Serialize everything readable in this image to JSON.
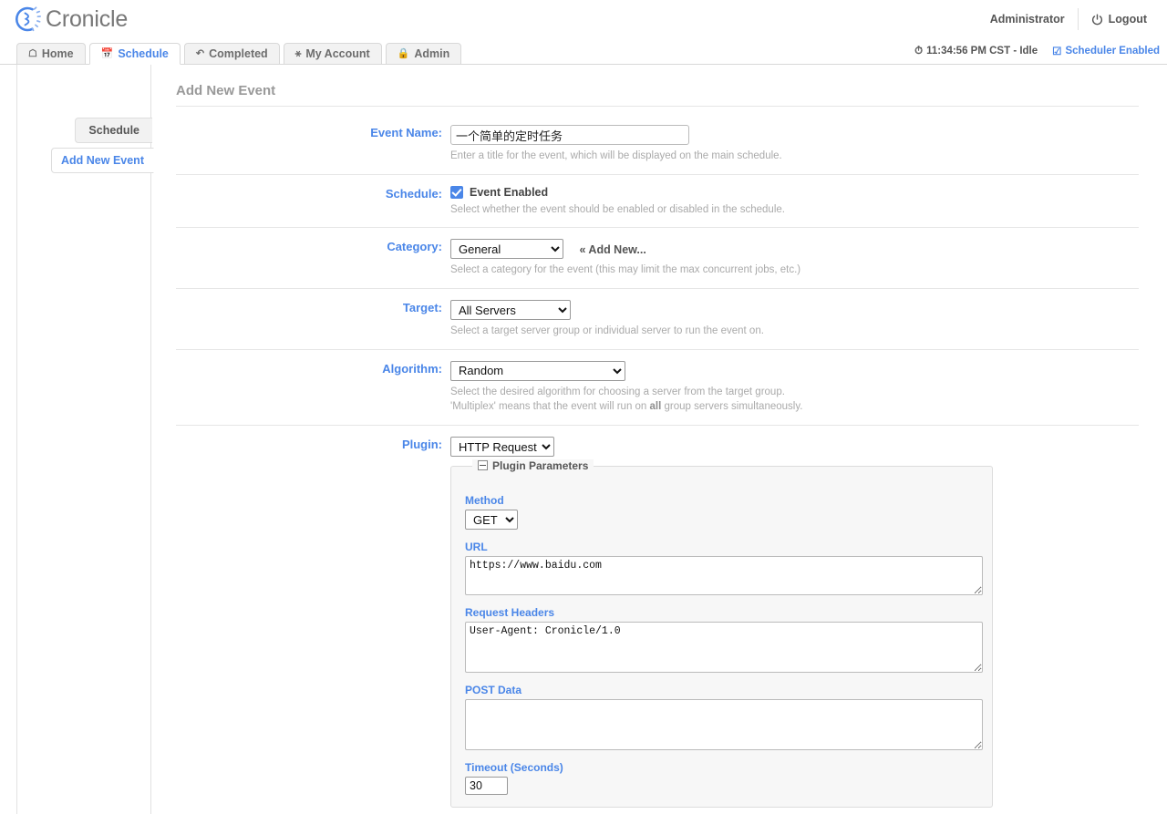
{
  "app": {
    "brand": "Cronicle",
    "logo_icon": "cronicle-clock-logo",
    "accent_color": "#4a86e8",
    "muted_color": "#aaaaaa"
  },
  "header": {
    "user_label": "Administrator",
    "logout_label": "Logout",
    "logout_icon": "power-icon"
  },
  "tabs": [
    {
      "label": "Home",
      "icon": "home-icon",
      "glyph": "⌂",
      "active": false
    },
    {
      "label": "Schedule",
      "icon": "calendar-clock-icon",
      "glyph": "Ὄ5",
      "active": true
    },
    {
      "label": "Completed",
      "icon": "history-icon",
      "glyph": "↺",
      "active": false
    },
    {
      "label": "My Account",
      "icon": "user-icon",
      "glyph": "⚹",
      "active": false
    },
    {
      "label": "Admin",
      "icon": "lock-icon",
      "glyph": "ὑ2",
      "active": false
    }
  ],
  "status_bar": {
    "clock_icon": "clock-icon",
    "time_text": "11:34:56 PM CST - Idle",
    "scheduler_check_icon": "checkbox-checked-icon",
    "scheduler_label": "Scheduler Enabled"
  },
  "sidebar": {
    "items": [
      {
        "label": "Schedule",
        "active": false
      },
      {
        "label": "Add New Event",
        "active": true
      }
    ]
  },
  "main": {
    "page_title": "Add New Event",
    "rows": {
      "event_name": {
        "label": "Event Name:",
        "value": "一个简单的定时任务",
        "placeholder": "",
        "caption": "Enter a title for the event, which will be displayed on the main schedule."
      },
      "schedule": {
        "label": "Schedule:",
        "checkbox_label": "Event Enabled",
        "checked": true,
        "caption": "Select whether the event should be enabled or disabled in the schedule."
      },
      "category": {
        "label": "Category:",
        "value": "General",
        "options": [
          "General"
        ],
        "add_new_label": "« Add New...",
        "caption": "Select a category for the event (this may limit the max concurrent jobs, etc.)"
      },
      "target": {
        "label": "Target:",
        "value": "All Servers",
        "options": [
          "All Servers"
        ],
        "caption": "Select a target server group or individual server to run the event on."
      },
      "algorithm": {
        "label": "Algorithm:",
        "value": "Random",
        "options": [
          "Random"
        ],
        "caption_line1": "Select the desired algorithm for choosing a server from the target group.",
        "caption_line2_pre": "'Multiplex' means that the event will run on ",
        "caption_line2_bold": "all",
        "caption_line2_post": " group servers simultaneously."
      },
      "plugin": {
        "label": "Plugin:",
        "value": "HTTP Request",
        "options": [
          "HTTP Request"
        ]
      }
    },
    "plugin_params": {
      "legend": "Plugin Parameters",
      "fields": {
        "method": {
          "label": "Method",
          "value": "GET",
          "options": [
            "GET"
          ]
        },
        "url": {
          "label": "URL",
          "value": "https://www.baidu.com"
        },
        "request_headers": {
          "label": "Request Headers",
          "value": "User-Agent: Cronicle/1.0"
        },
        "post_data": {
          "label": "POST Data",
          "value": ""
        },
        "timeout": {
          "label": "Timeout (Seconds)",
          "value": "30"
        }
      }
    }
  }
}
